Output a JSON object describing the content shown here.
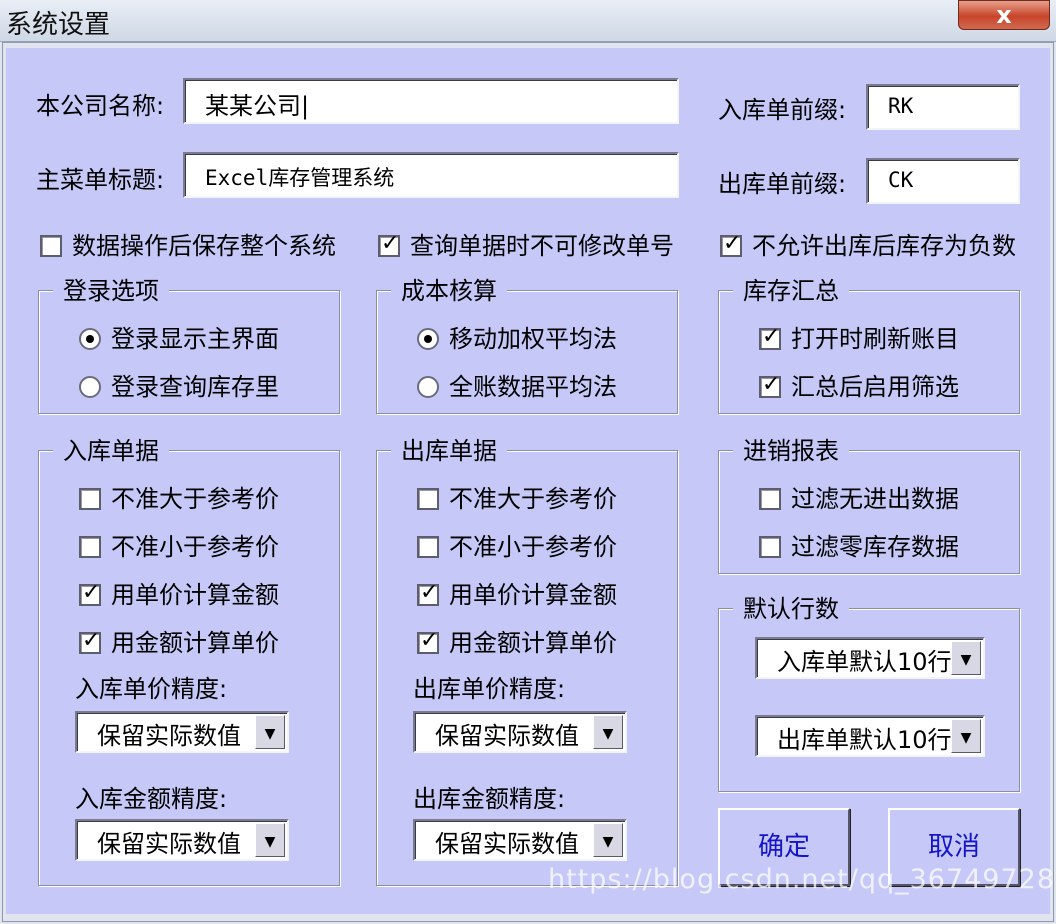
{
  "window": {
    "title": "系统设置",
    "close_glyph": "x"
  },
  "company": {
    "label": "本公司名称:",
    "value": "某某公司|"
  },
  "menu_title": {
    "label": "主菜单标题:",
    "value": "Excel库存管理系统"
  },
  "in_prefix": {
    "label": "入库单前缀:",
    "value": "RK"
  },
  "out_prefix": {
    "label": "出库单前缀:",
    "value": "CK"
  },
  "top_options": [
    {
      "label": "数据操作后保存整个系统",
      "checked": false
    },
    {
      "label": "查询单据时不可修改单号",
      "checked": true
    },
    {
      "label": "不允许出库后库存为负数",
      "checked": true
    }
  ],
  "login": {
    "title": "登录选项",
    "options": [
      {
        "label": "登录显示主界面",
        "selected": true
      },
      {
        "label": "登录查询库存里",
        "selected": false
      }
    ]
  },
  "cost": {
    "title": "成本核算",
    "options": [
      {
        "label": "移动加权平均法",
        "selected": true
      },
      {
        "label": "全账数据平均法",
        "selected": false
      }
    ]
  },
  "summary": {
    "title": "库存汇总",
    "options": [
      {
        "label": "打开时刷新账目",
        "checked": true
      },
      {
        "label": "汇总后启用筛选",
        "checked": true
      }
    ]
  },
  "in_doc": {
    "title": "入库单据",
    "options": [
      {
        "label": "不准大于参考价",
        "checked": false
      },
      {
        "label": "不准小于参考价",
        "checked": false
      },
      {
        "label": "用单价计算金额",
        "checked": true
      },
      {
        "label": "用金额计算单价",
        "checked": true
      }
    ],
    "price_precision_label": "入库单价精度:",
    "price_precision_value": "保留实际数值",
    "amount_precision_label": "入库金额精度:",
    "amount_precision_value": "保留实际数值"
  },
  "out_doc": {
    "title": "出库单据",
    "options": [
      {
        "label": "不准大于参考价",
        "checked": false
      },
      {
        "label": "不准小于参考价",
        "checked": false
      },
      {
        "label": "用单价计算金额",
        "checked": true
      },
      {
        "label": "用金额计算单价",
        "checked": true
      }
    ],
    "price_precision_label": "出库单价精度:",
    "price_precision_value": "保留实际数值",
    "amount_precision_label": "出库金额精度:",
    "amount_precision_value": "保留实际数值"
  },
  "report": {
    "title": "进销报表",
    "options": [
      {
        "label": "过滤无进出数据",
        "checked": false
      },
      {
        "label": "过滤零库存数据",
        "checked": false
      }
    ]
  },
  "default_rows": {
    "title": "默认行数",
    "in_value": "入库单默认10行",
    "out_value": "出库单默认10行"
  },
  "buttons": {
    "ok": "确定",
    "cancel": "取消"
  },
  "watermark": "https://blog.csdn.net/qq_36749728",
  "glyphs": {
    "check": "✓",
    "dropdown": "▼"
  },
  "colors": {
    "client_bg": "#c6c9f8",
    "button_text": "#1515c8"
  }
}
